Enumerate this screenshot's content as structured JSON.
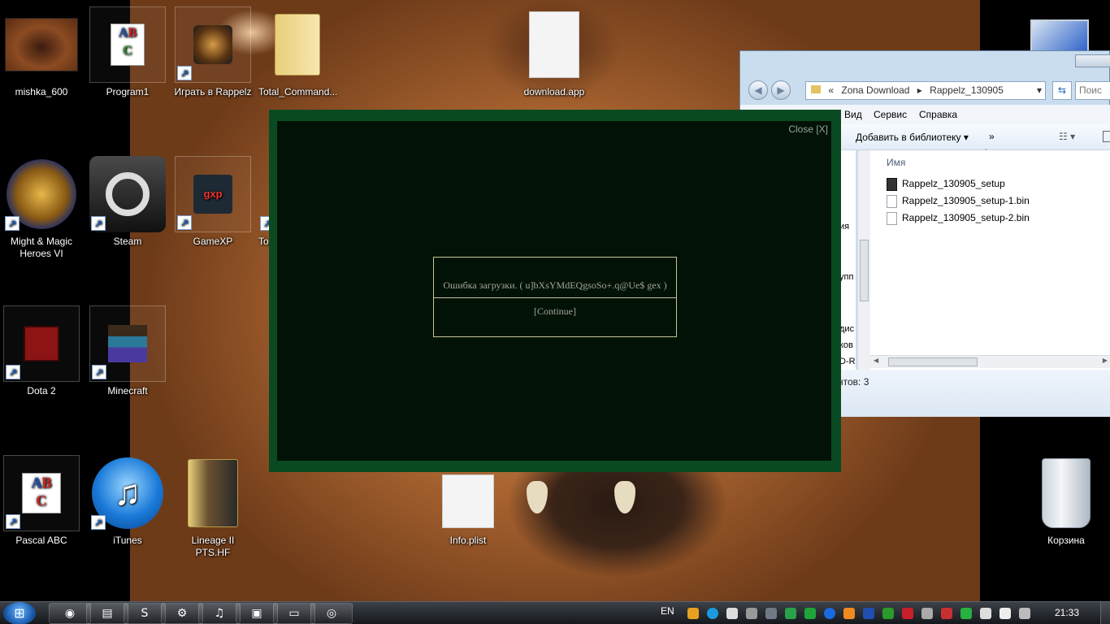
{
  "desktop": {
    "icons": [
      {
        "label": "mishka_600",
        "icon": "bear-photo-icon"
      },
      {
        "label": "Program1",
        "icon": "abc-document-icon"
      },
      {
        "label": "Играть в Rappelz",
        "icon": "rappelz-icon"
      },
      {
        "label": "Total_Command...",
        "icon": "folder-icon"
      },
      {
        "label": "download.app",
        "icon": "blank-file-icon"
      },
      {
        "label": "Might & Magic Heroes VI",
        "icon": "griffin-icon"
      },
      {
        "label": "Steam",
        "icon": "steam-icon"
      },
      {
        "label": "GameXP",
        "icon": "gamexp-icon"
      },
      {
        "label": "To",
        "icon": "shortcut-icon"
      },
      {
        "label": "Dota 2",
        "icon": "dota-icon"
      },
      {
        "label": "Minecraft",
        "icon": "minecraft-icon"
      },
      {
        "label": "Pascal ABC",
        "icon": "abc-icon"
      },
      {
        "label": "iTunes",
        "icon": "itunes-icon"
      },
      {
        "label": "Lineage II PTS.HF",
        "icon": "folder-icon"
      },
      {
        "label": "Info.plist",
        "icon": "blank-file-icon"
      },
      {
        "label": "Корзина",
        "icon": "recycle-bin-icon"
      }
    ]
  },
  "explorer": {
    "breadcrumb": [
      "Zona Download",
      "Rappelz_130905"
    ],
    "search_placeholder": "Поис",
    "menu": [
      "Вид",
      "Сервис",
      "Справка"
    ],
    "toolbar": {
      "add_to_library": "Добавить в библиотеку",
      "more": "»"
    },
    "column_name": "Имя",
    "files": [
      "Rappelz_130905_setup",
      "Rappelz_130905_setup-1.bin",
      "Rappelz_130905_setup-2.bin"
    ],
    "navpane_fragments": [
      "ия",
      "упп",
      "дис",
      "ков",
      "D-R"
    ],
    "status": "нтов: 3"
  },
  "modal": {
    "close_label": "Close [X]",
    "error_text": "Ошибка загрузки. ( u]bXsYMdEQgsoSo+.q@Ue$ gex )",
    "continue_label": "[Continue]"
  },
  "taskbar": {
    "language": "EN",
    "clock": "21:33",
    "pinned": [
      "chrome-icon",
      "explorer-icon",
      "skype-icon",
      "steam-icon",
      "itunes-icon",
      "floppy-icon",
      "monitor-icon",
      "rappelz-icon"
    ]
  },
  "colors": {
    "modal_border": "#0a4a22",
    "modal_bg": "#021206",
    "error_border": "#c8c69a",
    "error_text": "#a3a69a"
  }
}
